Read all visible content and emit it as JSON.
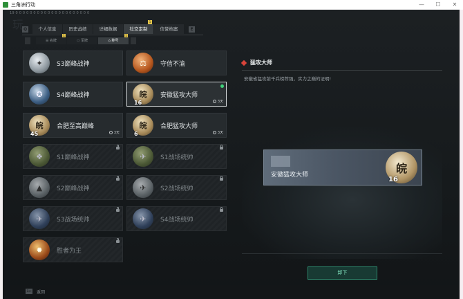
{
  "window": {
    "title": "三角洲行动"
  },
  "top_info": "19 0 0 0 0 0 0 0 0 0 0 0 0 0 0 0 0 0 0 0 0 0",
  "watermark": "玩",
  "tabs": [
    {
      "label": "个人信息",
      "badge": ""
    },
    {
      "label": "历史战绩",
      "badge": ""
    },
    {
      "label": "详细数据",
      "badge": ""
    },
    {
      "label": "社交定制",
      "badge": "1"
    },
    {
      "label": "信誉档案",
      "badge": ""
    }
  ],
  "tab_keys": {
    "left": "Q",
    "right": "E"
  },
  "subtabs": [
    {
      "label": "名牌",
      "badge": "1"
    },
    {
      "label": "军牌",
      "badge": ""
    },
    {
      "label": "称号",
      "badge": "1"
    }
  ],
  "titles": [
    {
      "label": "S3巅峰战神",
      "medal": "m-silver",
      "glyph": "✦",
      "locked": false,
      "num": "",
      "expire": "",
      "new": false
    },
    {
      "label": "守信不渝",
      "medal": "m-orange",
      "glyph": "⚖",
      "locked": false,
      "num": "",
      "expire": "",
      "new": false
    },
    {
      "label": "S4巅峰战神",
      "medal": "m-blue",
      "glyph": "✪",
      "locked": false,
      "num": "",
      "expire": "",
      "new": false
    },
    {
      "label": "安徽猛攻大师",
      "medal": "m-gold",
      "glyph": "皖",
      "locked": false,
      "num": "16",
      "expire": "3天",
      "new": true,
      "selected": true
    },
    {
      "label": "合肥至高巅峰",
      "medal": "m-gold",
      "glyph": "皖",
      "locked": false,
      "num": "45",
      "expire": "3天",
      "new": false
    },
    {
      "label": "合肥猛攻大师",
      "medal": "m-gold",
      "glyph": "皖",
      "locked": false,
      "num": "6",
      "expire": "3天",
      "new": false
    },
    {
      "label": "S1巅峰战神",
      "medal": "m-green",
      "glyph": "❖",
      "locked": true,
      "num": "",
      "expire": "",
      "new": false
    },
    {
      "label": "S1战场统帅",
      "medal": "m-green",
      "glyph": "✈",
      "locked": true,
      "num": "",
      "expire": "",
      "new": false
    },
    {
      "label": "S2巅峰战神",
      "medal": "m-gray",
      "glyph": "▲",
      "locked": true,
      "num": "",
      "expire": "",
      "new": false
    },
    {
      "label": "S2战场统帅",
      "medal": "m-gray",
      "glyph": "✈",
      "locked": true,
      "num": "",
      "expire": "",
      "new": false
    },
    {
      "label": "S3战场统帅",
      "medal": "m-navy",
      "glyph": "✈",
      "locked": true,
      "num": "",
      "expire": "",
      "new": false
    },
    {
      "label": "S4战场统帅",
      "medal": "m-navy",
      "glyph": "✈",
      "locked": true,
      "num": "",
      "expire": "",
      "new": false
    },
    {
      "label": "胜者为王",
      "medal": "m-red",
      "glyph": "✹",
      "locked": true,
      "num": "",
      "expire": "",
      "new": false
    }
  ],
  "detail": {
    "title": "猛攻大师",
    "description": "安徽省猛攻前千兵榜荐强，实力之巅的证明!",
    "banner_name": "安徽猛攻大师",
    "banner_glyph": "皖",
    "banner_num": "16"
  },
  "unequip_label": "卸下",
  "bottom": {
    "esc": "Esc",
    "back": "返回"
  },
  "colors": {
    "accent": "#2e8a6e",
    "new_dot": "#3fd27b",
    "badge": "#e2c449"
  }
}
